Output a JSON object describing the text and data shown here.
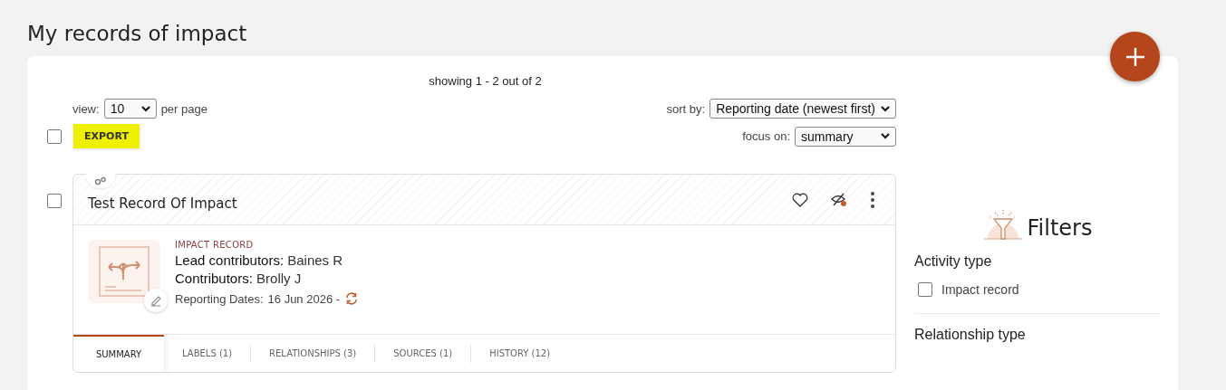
{
  "page_title": "My records of impact",
  "showing": "showing 1 - 2 out of 2",
  "view": {
    "label": "view:",
    "value": "10",
    "suffix": "per page"
  },
  "sort": {
    "label": "sort by:",
    "value": "Reporting date (newest first)"
  },
  "focus": {
    "label": "focus on:",
    "value": "summary"
  },
  "select_all": {
    "checked": false
  },
  "export_button": {
    "label": "EXPORT",
    "highlighted": true
  },
  "records": [
    {
      "title": "Test Record Of Impact",
      "checked": false,
      "favourite": false,
      "type": "IMPACT RECORD",
      "lines": [
        {
          "label": "Lead contributors:",
          "value": "Baines R"
        },
        {
          "label": "Contributors:",
          "value": "Brolly J"
        }
      ],
      "dates_label": "Reporting Dates:",
      "dates": "16 Jun 2026 -",
      "tabs": [
        {
          "label": "SUMMARY",
          "selected": true
        },
        {
          "label": "LABELS (1)",
          "selected": false
        },
        {
          "label": "RELATIONSHIPS (3)",
          "selected": false
        },
        {
          "label": "SOURCES (1)",
          "selected": false
        },
        {
          "label": "HISTORY (12)",
          "selected": false
        }
      ]
    }
  ],
  "filters": {
    "title": "Filters",
    "groups": [
      {
        "title": "Activity type",
        "options": [
          {
            "label": "Impact record",
            "checked": false
          }
        ]
      },
      {
        "title": "Relationship type"
      }
    ]
  }
}
